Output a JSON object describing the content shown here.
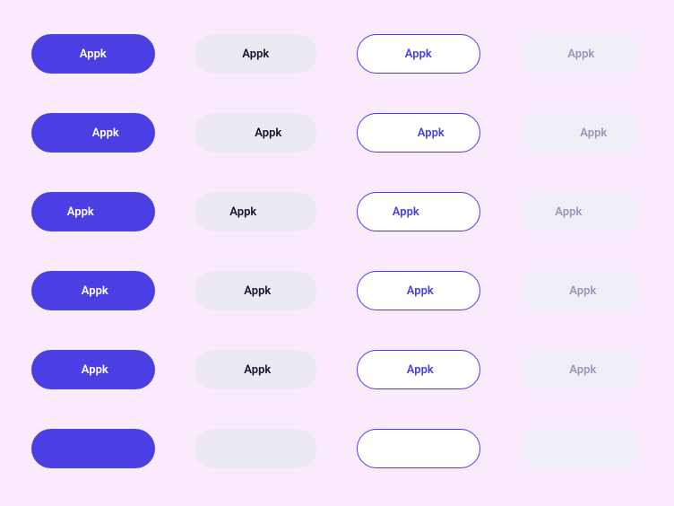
{
  "label": "Appk",
  "colors": {
    "primary_bg": "#4b3fe4",
    "primary_fg": "#ffffff",
    "secondary_bg": "#ece9f2",
    "secondary_fg": "#14132b",
    "outline_bg": "#ffffff",
    "outline_border": "#4b3fe4",
    "outline_fg": "#4b3fe4",
    "ghost_bg": "#f2eef7",
    "ghost_fg": "#9b96b8",
    "page_bg": "#faebfc"
  },
  "variants": [
    "primary",
    "secondary",
    "outline",
    "ghost"
  ],
  "rows": [
    {
      "kind": "text-only"
    },
    {
      "kind": "icon-left-text"
    },
    {
      "kind": "text-icon-right"
    },
    {
      "kind": "icon-left-text-chevron"
    },
    {
      "kind": "text-chevron"
    },
    {
      "kind": "icon-only"
    }
  ]
}
